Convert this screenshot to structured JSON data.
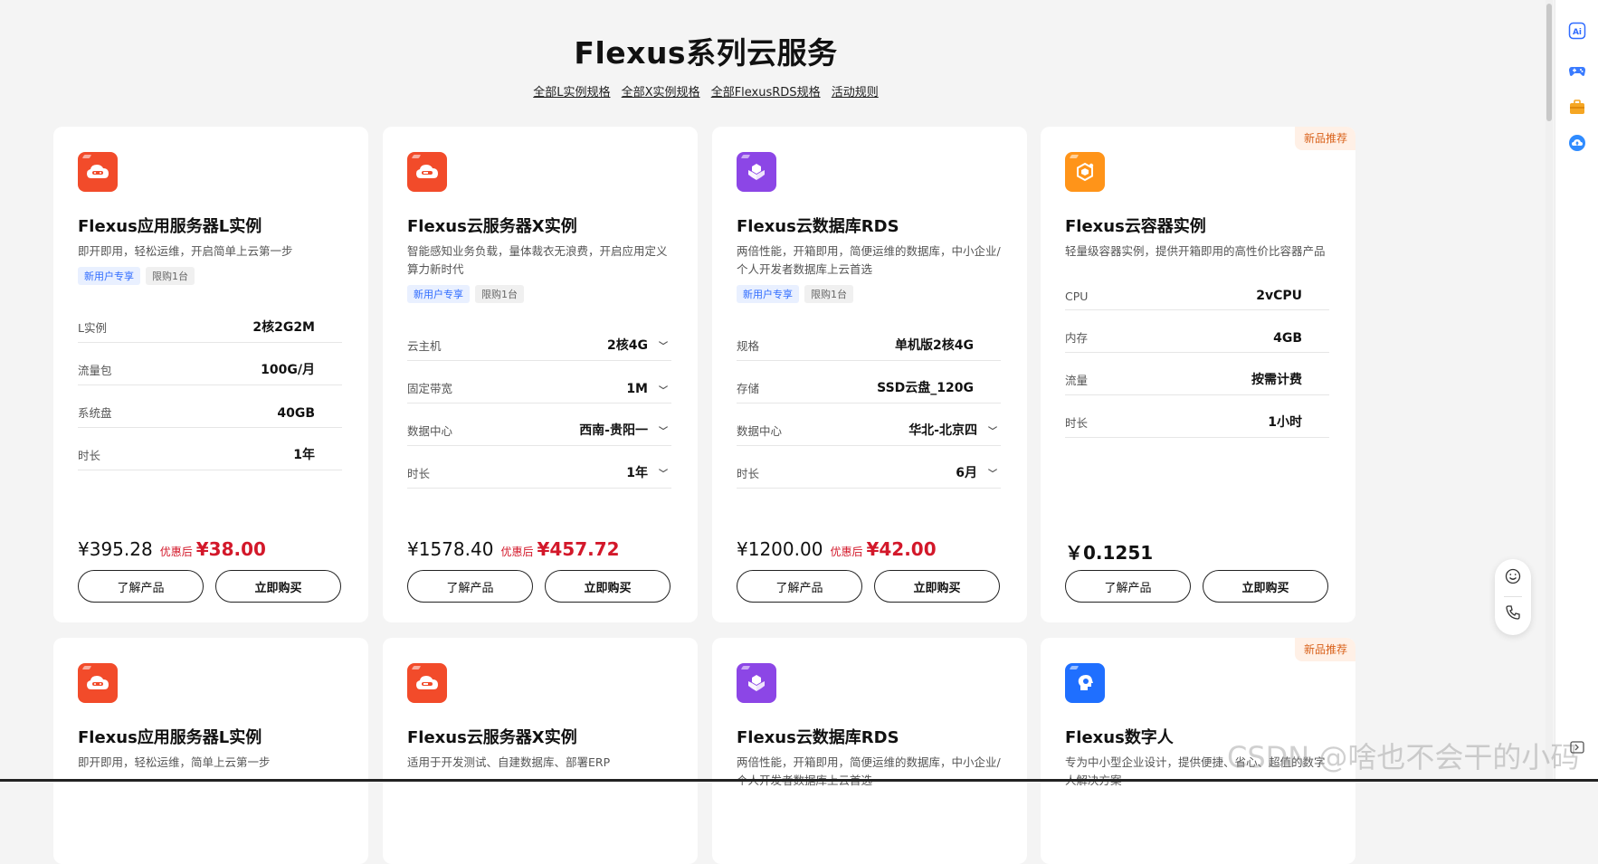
{
  "page": {
    "title": "Flexus系列云服务",
    "links": [
      "全部L实例规格",
      "全部X实例规格",
      "全部FlexusRDS规格",
      "活动规则"
    ]
  },
  "cards_row1": [
    {
      "name": "Flexus应用服务器L实例",
      "desc": "即开即用，轻松运维，开启简单上云第一步",
      "tags": [
        "新用户专享",
        "限购1台"
      ],
      "icon": "cloud-server-icon",
      "icon_color": "#f24b2a",
      "specs": [
        {
          "k": "L实例",
          "v": "2核2G2M"
        },
        {
          "k": "流量包",
          "v": "100G/月"
        },
        {
          "k": "系统盘",
          "v": "40GB"
        },
        {
          "k": "时长",
          "v": "1年"
        }
      ],
      "orig_price": "¥395.28",
      "after_label": "优惠后",
      "deal_price": "¥38.00",
      "learn": "了解产品",
      "buy": "立即购买"
    },
    {
      "name": "Flexus云服务器X实例",
      "desc": "智能感知业务负载，量体裁衣无浪费，开启应用定义算力新时代",
      "tags": [
        "新用户专享",
        "限购1台"
      ],
      "icon": "cloud-server-x-icon",
      "icon_color": "#f24b2a",
      "specs": [
        {
          "k": "云主机",
          "v": "2核4G"
        },
        {
          "k": "固定带宽",
          "v": "1M"
        },
        {
          "k": "数据中心",
          "v": "西南-贵阳一"
        },
        {
          "k": "时长",
          "v": "1年"
        }
      ],
      "orig_price": "¥1578.40",
      "after_label": "优惠后",
      "deal_price": "¥457.72",
      "learn": "了解产品",
      "buy": "立即购买"
    },
    {
      "name": "Flexus云数据库RDS",
      "desc": "两倍性能，开箱即用，简便运维的数据库，中小企业/个人开发者数据库上云首选",
      "tags": [
        "新用户专享",
        "限购1台"
      ],
      "icon": "database-icon",
      "icon_color": "#8c46e6",
      "specs": [
        {
          "k": "规格",
          "v": "单机版2核4G"
        },
        {
          "k": "存储",
          "v": "SSD云盘_120G"
        },
        {
          "k": "数据中心",
          "v": "华北-北京四"
        },
        {
          "k": "时长",
          "v": "6月"
        }
      ],
      "orig_price": "¥1200.00",
      "after_label": "优惠后",
      "deal_price": "¥42.00",
      "learn": "了解产品",
      "buy": "立即购买"
    },
    {
      "badge": "新品推荐",
      "name": "Flexus云容器实例",
      "desc": "轻量级容器实例，提供开箱即用的高性价比容器产品",
      "icon": "container-icon",
      "icon_color": "#ff9419",
      "specs": [
        {
          "k": "CPU",
          "v": "2vCPU"
        },
        {
          "k": "内存",
          "v": "4GB"
        },
        {
          "k": "流量",
          "v": "按需计费"
        },
        {
          "k": "时长",
          "v": "1小时"
        }
      ],
      "orig_price": "￥0.1251",
      "learn": "了解产品",
      "buy": "立即购买"
    }
  ],
  "cards_row2": [
    {
      "name": "Flexus应用服务器L实例",
      "desc": "即开即用，轻松运维，简单上云第一步",
      "icon_color": "#f24b2a"
    },
    {
      "name": "Flexus云服务器X实例",
      "desc": "适用于开发测试、自建数据库、部署ERP",
      "icon_color": "#f24b2a"
    },
    {
      "name": "Flexus云数据库RDS",
      "desc": "两倍性能，开箱即用，简便运维的数据库，中小企业/个人开发者数据库上云首选",
      "icon_color": "#8c46e6"
    },
    {
      "badge": "新品推荐",
      "name": "Flexus数字人",
      "desc": "专为中小型企业设计，提供便捷、省心、超值的数字人解决方案",
      "icon_color": "#1f6fff"
    }
  ],
  "watermark": "CSDN @啥也不会干的小码"
}
